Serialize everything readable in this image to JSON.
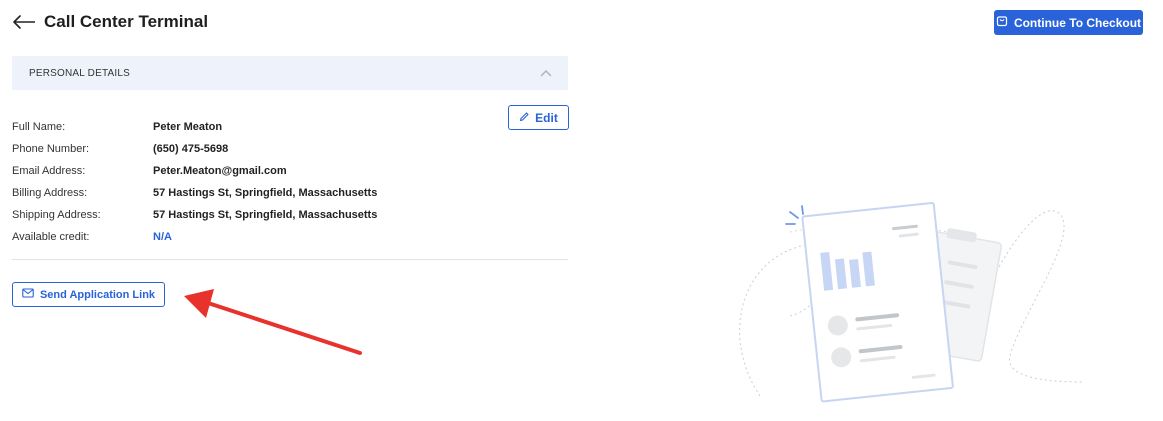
{
  "header": {
    "title": "Call Center Terminal",
    "back_icon": "arrow-left-icon"
  },
  "toolbar": {
    "checkout_label": "Continue To Checkout",
    "checkout_icon": "cart-icon",
    "accent_color": "#2962d9"
  },
  "section": {
    "title": "PERSONAL DETAILS",
    "collapse_icon": "chevron-up-icon",
    "background": "#eef3fb"
  },
  "edit": {
    "label": "Edit",
    "icon": "pencil-icon"
  },
  "details": [
    {
      "label": "Full Name:",
      "value": "Peter Meaton"
    },
    {
      "label": "Phone Number:",
      "value": "(650) 475-5698"
    },
    {
      "label": "Email Address:",
      "value": "Peter.Meaton@gmail.com"
    },
    {
      "label": "Billing Address:",
      "value": "57 Hastings St, Springfield, Massachusetts"
    },
    {
      "label": "Shipping Address:",
      "value": "57 Hastings St, Springfield, Massachusetts"
    },
    {
      "label": "Available credit:",
      "value": "N/A"
    }
  ],
  "actions": {
    "send_link_label": "Send Application Link",
    "send_link_icon": "mail-icon"
  },
  "annotation": {
    "arrow_color": "#e8322c"
  }
}
